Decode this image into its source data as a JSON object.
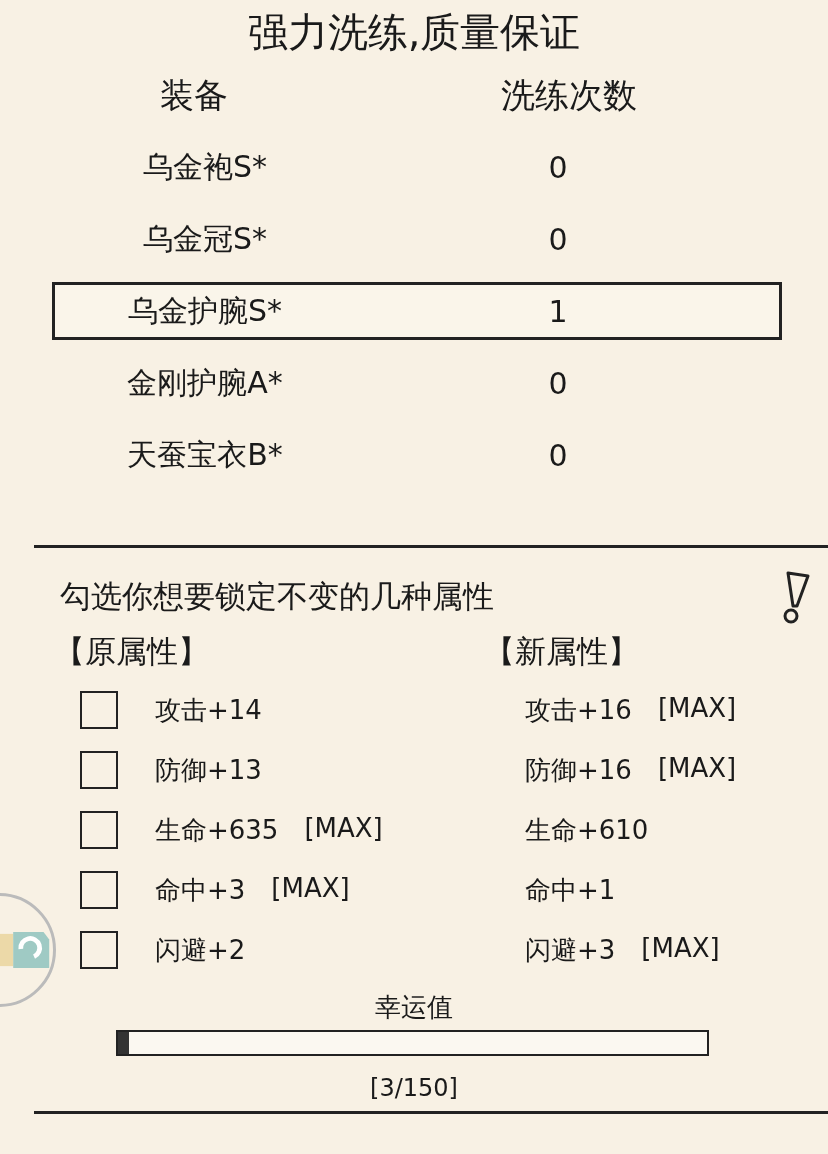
{
  "title": "强力洗练,质量保证",
  "equipment": {
    "columns": [
      "装备",
      "洗练次数"
    ],
    "rows": [
      {
        "name": "乌金袍S*",
        "count": "0",
        "selected": false
      },
      {
        "name": "乌金冠S*",
        "count": "0",
        "selected": false
      },
      {
        "name": "乌金护腕S*",
        "count": "1",
        "selected": true
      },
      {
        "name": "金刚护腕A*",
        "count": "0",
        "selected": false
      },
      {
        "name": "天蚕宝衣B*",
        "count": "0",
        "selected": false
      }
    ]
  },
  "lock_panel": {
    "prompt": "勾选你想要锁定不变的几种属性",
    "old_heading": "【原属性】",
    "new_heading": "【新属性】",
    "attributes": [
      {
        "checked": false,
        "old": "攻击+14",
        "new": "攻击+16",
        "new_tag": "[MAX]"
      },
      {
        "checked": false,
        "old": "防御+13",
        "new": "防御+16",
        "new_tag": "[MAX]"
      },
      {
        "checked": false,
        "old": "生命+635",
        "old_tag": "[MAX]",
        "new": "生命+610"
      },
      {
        "checked": false,
        "old": "命中+3",
        "old_tag": "[MAX]",
        "new": "命中+1"
      },
      {
        "checked": false,
        "old": "闪避+2",
        "new": "闪避+3",
        "new_tag": "[MAX]"
      }
    ],
    "luck": {
      "label": "幸运值",
      "level": 0.02,
      "reading": "[3/150]"
    }
  }
}
